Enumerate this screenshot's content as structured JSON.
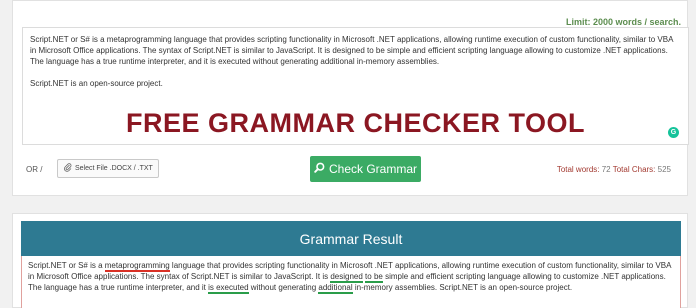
{
  "limit_label": "Limit: 2000 words / search.",
  "editor": {
    "paragraph1": "Script.NET or S# is a metaprogramming language that provides scripting functionality in Microsoft .NET applications, allowing runtime execution of custom functionality, similar to VBA in Microsoft Office applications. The syntax of Script.NET is similar to JavaScript. It is designed to be simple and efficient scripting language allowing to customize .NET applications. The language has a true runtime interpreter, and it is executed without generating additional in-memory assemblies.",
    "paragraph2": "Script.NET is an open-source project.",
    "grammarly_badge": "G"
  },
  "banner": "FREE GRAMMAR CHECKER TOOL",
  "toolbar": {
    "or_label": "OR /",
    "file_icon": "paperclip-icon",
    "file_button": "Select File .DOCX / .TXT",
    "check_icon": "search-icon",
    "check_button": "Check Grammar",
    "total_words_label": "Total words:",
    "total_words": "72",
    "total_chars_label": "Total Chars:",
    "total_chars": "525"
  },
  "result": {
    "header": "Grammar Result",
    "t1": "Script.NET or S# is a ",
    "e1": "metaprogramming",
    "t2": " language that provides scripting functionality in Microsoft .NET applications, allowing runtime execution of custom functionality, similar to VBA in Microsoft Office applications. The syntax of Script.NET is similar to JavaScript. It is ",
    "e2": "designed",
    "t3": " ",
    "e3": "to be",
    "t4": " simple and efficient scripting language allowing to customize .NET applications. The language has a true runtime interpreter, and it ",
    "e4": "is executed",
    "t5": " without generating ",
    "e5": "additional",
    "t6": " in-memory assemblies. Script.NET is an open-source project."
  },
  "colors": {
    "banner": "#8b1722",
    "check_button": "#3bab64",
    "result_header": "#2e7a92",
    "error_underline_red": "#d93025",
    "error_underline_green": "#2a9d4a"
  }
}
